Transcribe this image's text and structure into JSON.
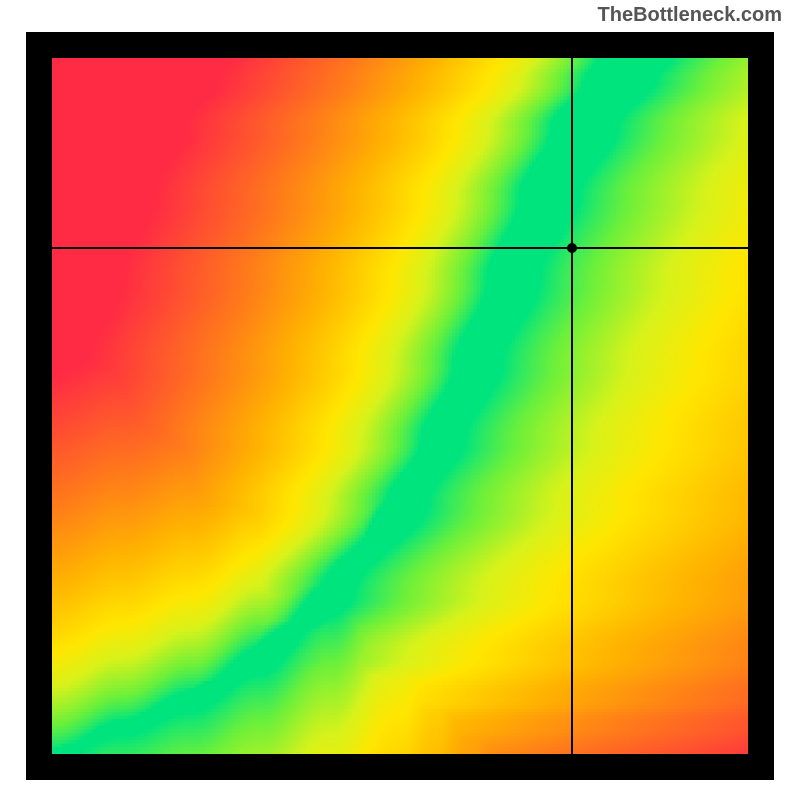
{
  "attribution": "TheBottleneck.com",
  "chart_data": {
    "type": "heatmap",
    "title": "",
    "xlabel": "",
    "ylabel": "",
    "xlim": [
      0,
      1
    ],
    "ylim": [
      0,
      1
    ],
    "grid_size": 200,
    "crosshair": {
      "x": 0.747,
      "y": 0.727
    },
    "marker": {
      "x": 0.747,
      "y": 0.727
    },
    "ridge": {
      "description": "Low-distance (green) ridge following a monotone curve from lower-left to upper-right; distance increases (yellow→orange→red) away from the ridge.",
      "control_points_xy": [
        [
          0.0,
          0.0
        ],
        [
          0.1,
          0.04
        ],
        [
          0.2,
          0.08
        ],
        [
          0.3,
          0.14
        ],
        [
          0.4,
          0.23
        ],
        [
          0.5,
          0.36
        ],
        [
          0.55,
          0.45
        ],
        [
          0.6,
          0.56
        ],
        [
          0.65,
          0.68
        ],
        [
          0.7,
          0.8
        ],
        [
          0.75,
          0.9
        ],
        [
          0.8,
          0.97
        ],
        [
          0.82,
          1.0
        ]
      ]
    },
    "colorscale": {
      "stops": [
        {
          "t": 0.0,
          "color": "#00e47e"
        },
        {
          "t": 0.1,
          "color": "#6bf03a"
        },
        {
          "t": 0.22,
          "color": "#d7f21a"
        },
        {
          "t": 0.32,
          "color": "#ffe600"
        },
        {
          "t": 0.5,
          "color": "#ffb300"
        },
        {
          "t": 0.7,
          "color": "#ff7a1a"
        },
        {
          "t": 0.88,
          "color": "#ff4a33"
        },
        {
          "t": 1.0,
          "color": "#ff2a44"
        }
      ]
    }
  }
}
